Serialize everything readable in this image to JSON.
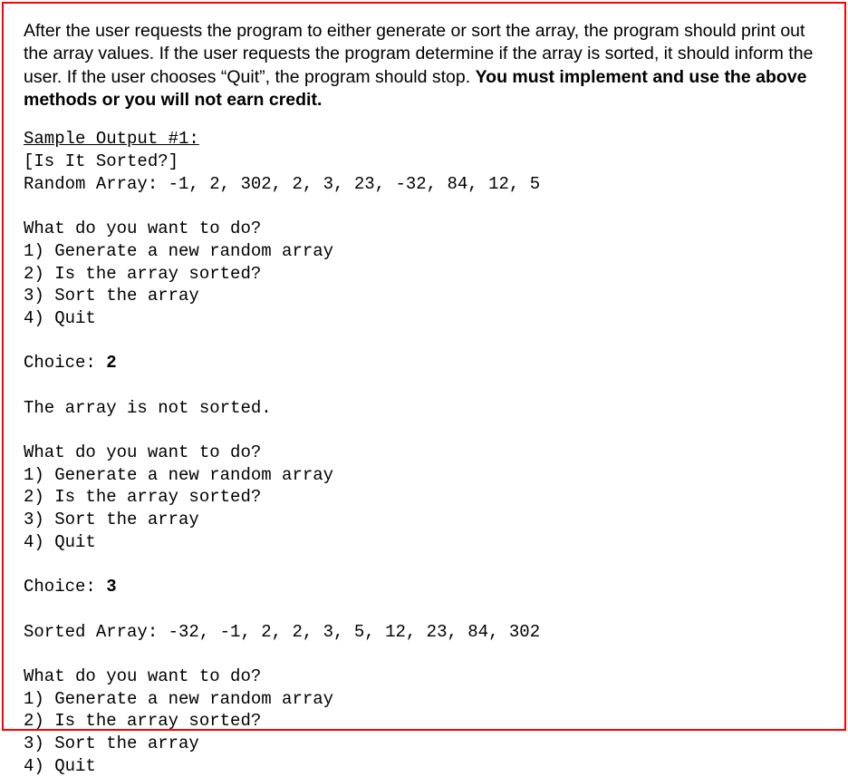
{
  "instructions": {
    "text_start": "After the user requests the program to either generate or sort the array, the program should print out the array values. If the user requests the program determine if the array is sorted, it should inform the user. If the user chooses “Quit”, the program should stop. ",
    "text_bold": "You must implement and use the above methods or you will not earn credit."
  },
  "sample_header": "Sample Output #1:",
  "intro_block": "[Is It Sorted?]\nRandom Array: -1, 2, 302, 2, 3, 23, -32, 84, 12, 5",
  "menu_prompt": "What do you want to do?\n1) Generate a new random array\n2) Is the array sorted?\n3) Sort the array\n4) Quit",
  "choice_label": "Choice: ",
  "choice_1": "2",
  "response_1": "The array is not sorted.",
  "choice_2": "3",
  "response_2": "Sorted Array: -32, -1, 2, 2, 3, 5, 12, 23, 84, 302"
}
